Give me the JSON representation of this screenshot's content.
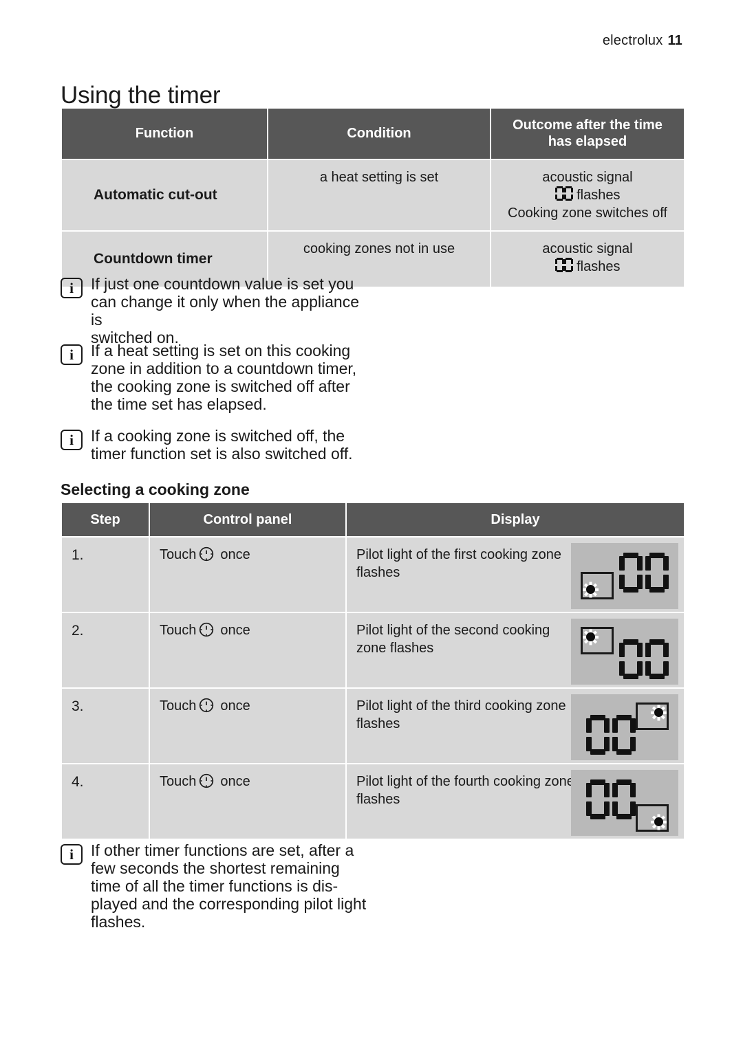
{
  "header": {
    "brand": "electrolux",
    "page_number": "11"
  },
  "page_title": "Using the timer",
  "timer_functions_table": {
    "columns": [
      "Function",
      "Condition",
      "Outcome after the time has elapsed"
    ],
    "columns_display": {
      "col1": "Function",
      "col2": "Condition",
      "col3_line1": "Outcome after the time",
      "col3_line2": "has elapsed"
    },
    "rows": [
      {
        "function": "Automatic cut-out",
        "condition": "a heat setting is set",
        "outcome_line1": "acoustic signal",
        "outcome_digits": "00",
        "outcome_line2_suffix": " flashes",
        "outcome_line3": "Cooking zone switches off"
      },
      {
        "function": "Countdown timer",
        "condition": "cooking zones not in use",
        "outcome_line1": "acoustic signal",
        "outcome_digits": "00",
        "outcome_line2_suffix": " flashes",
        "outcome_line3": ""
      }
    ]
  },
  "notes": [
    {
      "icon": "info-icon",
      "glyph": "i",
      "text": "If just one countdown value is set you\ncan change it only when the appliance is\nswitched on."
    },
    {
      "icon": "info-icon",
      "glyph": "i",
      "text": "If a heat setting is set on this cooking\nzone in addition to a countdown timer,\nthe cooking zone is switched off after\nthe time set has elapsed."
    },
    {
      "icon": "info-icon",
      "glyph": "i",
      "text": "If a cooking zone is switched off, the\ntimer function set is also switched off."
    },
    {
      "icon": "info-icon",
      "glyph": "i",
      "text": "If other timer functions are set, after a\nfew seconds the shortest remaining\ntime of all the timer functions is dis-\nplayed and the corresponding pilot light\nflashes."
    }
  ],
  "subheading": "Selecting a cooking zone",
  "selecting_zone_table": {
    "columns": [
      "Step",
      "Control panel",
      "Display"
    ],
    "rows": [
      {
        "step": "1.",
        "control_prefix": "Touch",
        "control_icon": "clock-icon",
        "control_suffix": "once",
        "display_text": "Pilot light of the first cooking zone flashes",
        "display_digits": "00",
        "display_variant": "v1",
        "display_pilot_position": "bottom-left, box left of digits"
      },
      {
        "step": "2.",
        "control_prefix": "Touch",
        "control_icon": "clock-icon",
        "control_suffix": "once",
        "display_text": "Pilot light of the second cooking zone flashes",
        "display_digits": "00",
        "display_variant": "v2",
        "display_pilot_position": "top-left, box left of digits"
      },
      {
        "step": "3.",
        "control_prefix": "Touch",
        "control_icon": "clock-icon",
        "control_suffix": "once",
        "display_text": "Pilot light of the third cooking zone flashes",
        "display_digits": "00",
        "display_variant": "v3",
        "display_pilot_position": "top-right, box right of digits"
      },
      {
        "step": "4.",
        "control_prefix": "Touch",
        "control_icon": "clock-icon",
        "control_suffix": "once",
        "display_text": "Pilot light of the fourth cooking zone flashes",
        "display_digits": "00",
        "display_variant": "v4",
        "display_pilot_position": "bottom-right, box right of digits"
      }
    ]
  },
  "colors": {
    "header_row": "#575757",
    "header_text": "#ffffff",
    "body_cell": "#d8d8d8",
    "lcd_panel": "#b9b9b9",
    "segment": "#121212",
    "text": "#1a1a1a",
    "page_background": "#ffffff"
  }
}
